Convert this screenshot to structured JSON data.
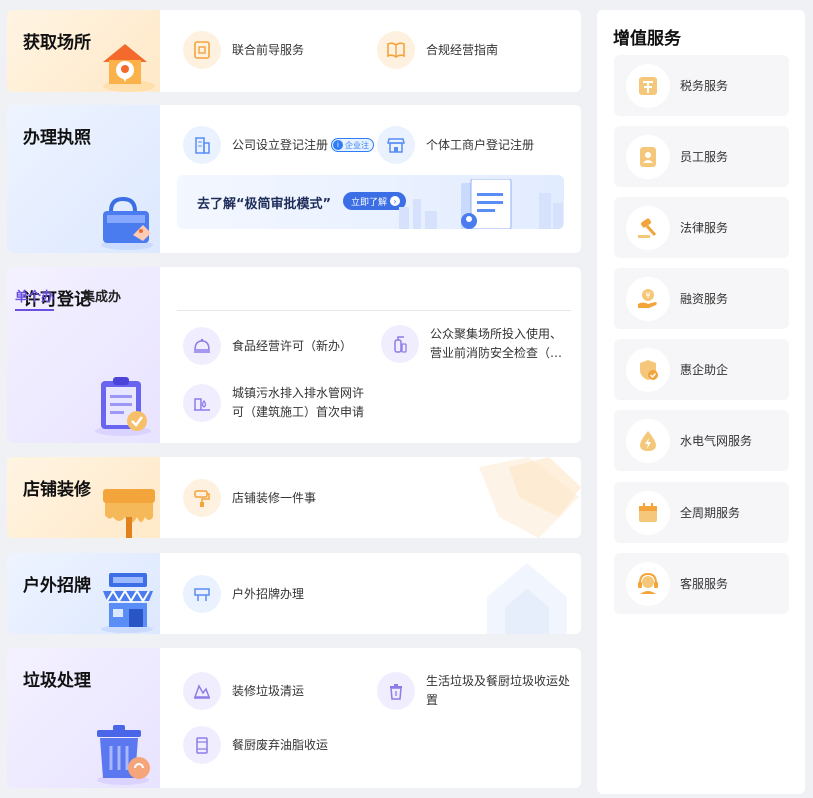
{
  "sections": {
    "venue": {
      "title": "获取场所",
      "items": [
        {
          "label": "联合前导服务",
          "icon": "document-icon"
        },
        {
          "label": "合规经营指南",
          "icon": "book-icon"
        }
      ]
    },
    "license": {
      "title": "办理执照",
      "items": [
        {
          "label": "公司设立登记注册",
          "icon": "building-icon",
          "tag": "企业注"
        },
        {
          "label": "个体工商户登记注册",
          "icon": "storefront-icon"
        }
      ],
      "banner": {
        "text": "去了解“极简审批模式”",
        "button": "立即了解"
      }
    },
    "permit": {
      "title": "许可登记",
      "tabs": [
        "单个办",
        "集成办"
      ],
      "items": [
        {
          "label": "食品经营许可（新办）",
          "icon": "food-cover-icon"
        },
        {
          "label": "公众聚集场所投入使用、营业前消防安全检查（…",
          "icon": "fire-extinguisher-icon"
        },
        {
          "label": "城镇污水排入排水管网许可（建筑施工）首次申请",
          "icon": "water-pipe-icon"
        }
      ]
    },
    "renovation": {
      "title": "店铺装修",
      "items": [
        {
          "label": "店铺装修一件事",
          "icon": "paint-roller-icon"
        }
      ]
    },
    "signboard": {
      "title": "户外招牌",
      "items": [
        {
          "label": "户外招牌办理",
          "icon": "signboard-icon"
        }
      ]
    },
    "waste": {
      "title": "垃圾处理",
      "items": [
        {
          "label": "装修垃圾清运",
          "icon": "debris-icon"
        },
        {
          "label": "生活垃圾及餐厨垃圾收运处置",
          "icon": "trash-can-icon"
        },
        {
          "label": "餐厨废弃油脂收运",
          "icon": "oil-barrel-icon"
        }
      ]
    }
  },
  "sidebar": {
    "title": "增值服务",
    "items": [
      {
        "label": "税务服务",
        "icon": "tax-icon"
      },
      {
        "label": "员工服务",
        "icon": "employee-badge-icon"
      },
      {
        "label": "法律服务",
        "icon": "gavel-icon"
      },
      {
        "label": "融资服务",
        "icon": "coin-hand-icon"
      },
      {
        "label": "惠企助企",
        "icon": "shield-check-icon"
      },
      {
        "label": "水电气网服务",
        "icon": "energy-drop-icon"
      },
      {
        "label": "全周期服务",
        "icon": "calendar-icon"
      },
      {
        "label": "客服服务",
        "icon": "headset-icon"
      }
    ]
  },
  "colors": {
    "accent_purple": "#6a4fe0",
    "accent_blue": "#2f7df6",
    "orange_icon": "#f3a43b",
    "blue_icon": "#5b8df6",
    "purple_icon": "#8d7ce8"
  }
}
